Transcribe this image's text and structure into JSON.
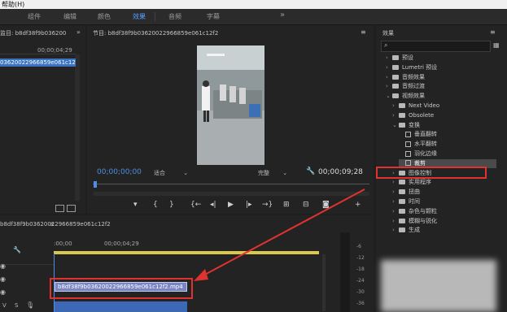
{
  "menu": {
    "help": "帮助(H)"
  },
  "workspaces": [
    {
      "label": "组件"
    },
    {
      "label": "编辑"
    },
    {
      "label": "颜色"
    },
    {
      "label": "效果",
      "active": true
    },
    {
      "label": "音频"
    },
    {
      "label": "字幕"
    },
    {
      "label": "»"
    }
  ],
  "source_panel": {
    "title": "监目: b8df38f9b036200",
    "clip_time": "00;00;04;29",
    "selected_item": "03620022966859e061c12f2.m"
  },
  "program": {
    "title": "节目: b8df38f9b03620022966859e061c12f2",
    "timecode_current": "00;00;00;00",
    "fit": "适合",
    "quality": "完整",
    "timecode_duration": "00;00;09;28"
  },
  "effects_panel": {
    "title": "效果",
    "items": [
      {
        "label": "预设",
        "type": "folder",
        "depth": 0,
        "open": false
      },
      {
        "label": "Lumetri 预设",
        "type": "folder",
        "depth": 0,
        "open": false
      },
      {
        "label": "音频效果",
        "type": "folder",
        "depth": 0,
        "open": false
      },
      {
        "label": "音频过渡",
        "type": "folder",
        "depth": 0,
        "open": false
      },
      {
        "label": "视频效果",
        "type": "folder",
        "depth": 0,
        "open": true
      },
      {
        "label": "Next Video",
        "type": "folder",
        "depth": 1,
        "open": false
      },
      {
        "label": "Obsolete",
        "type": "folder",
        "depth": 1,
        "open": false
      },
      {
        "label": "变换",
        "type": "folder",
        "depth": 1,
        "open": true
      },
      {
        "label": "垂直翻转",
        "type": "effect",
        "depth": 2
      },
      {
        "label": "水平翻转",
        "type": "effect",
        "depth": 2
      },
      {
        "label": "羽化边缘",
        "type": "effect",
        "depth": 2
      },
      {
        "label": "裁剪",
        "type": "effect",
        "depth": 2,
        "selected": true
      },
      {
        "label": "图像控制",
        "type": "folder",
        "depth": 1,
        "open": false
      },
      {
        "label": "实用程序",
        "type": "folder",
        "depth": 1,
        "open": false
      },
      {
        "label": "扭曲",
        "type": "folder",
        "depth": 1,
        "open": false
      },
      {
        "label": "时间",
        "type": "folder",
        "depth": 1,
        "open": false
      },
      {
        "label": "杂色与颗粒",
        "type": "folder",
        "depth": 1,
        "open": false
      },
      {
        "label": "模糊与锐化",
        "type": "folder",
        "depth": 1,
        "open": false
      },
      {
        "label": "生成",
        "type": "folder",
        "depth": 1,
        "open": false
      }
    ]
  },
  "timeline": {
    "title": "b8df38f9b03620022966859e061c12f2",
    "ruler_start": ":00;00",
    "ruler_mid": "00;00;04;29",
    "clip_name": "b8df38f9b03620022966859e061c12f2.mp4",
    "track_v": "V",
    "track_s": "S"
  },
  "meters": {
    "ticks": [
      "-6",
      "-12",
      "-18",
      "-24",
      "-30",
      "-36"
    ]
  },
  "colors": {
    "accent": "#4c8fe6",
    "highlight": "#e0332f",
    "selected_item": "#3a73c2"
  }
}
